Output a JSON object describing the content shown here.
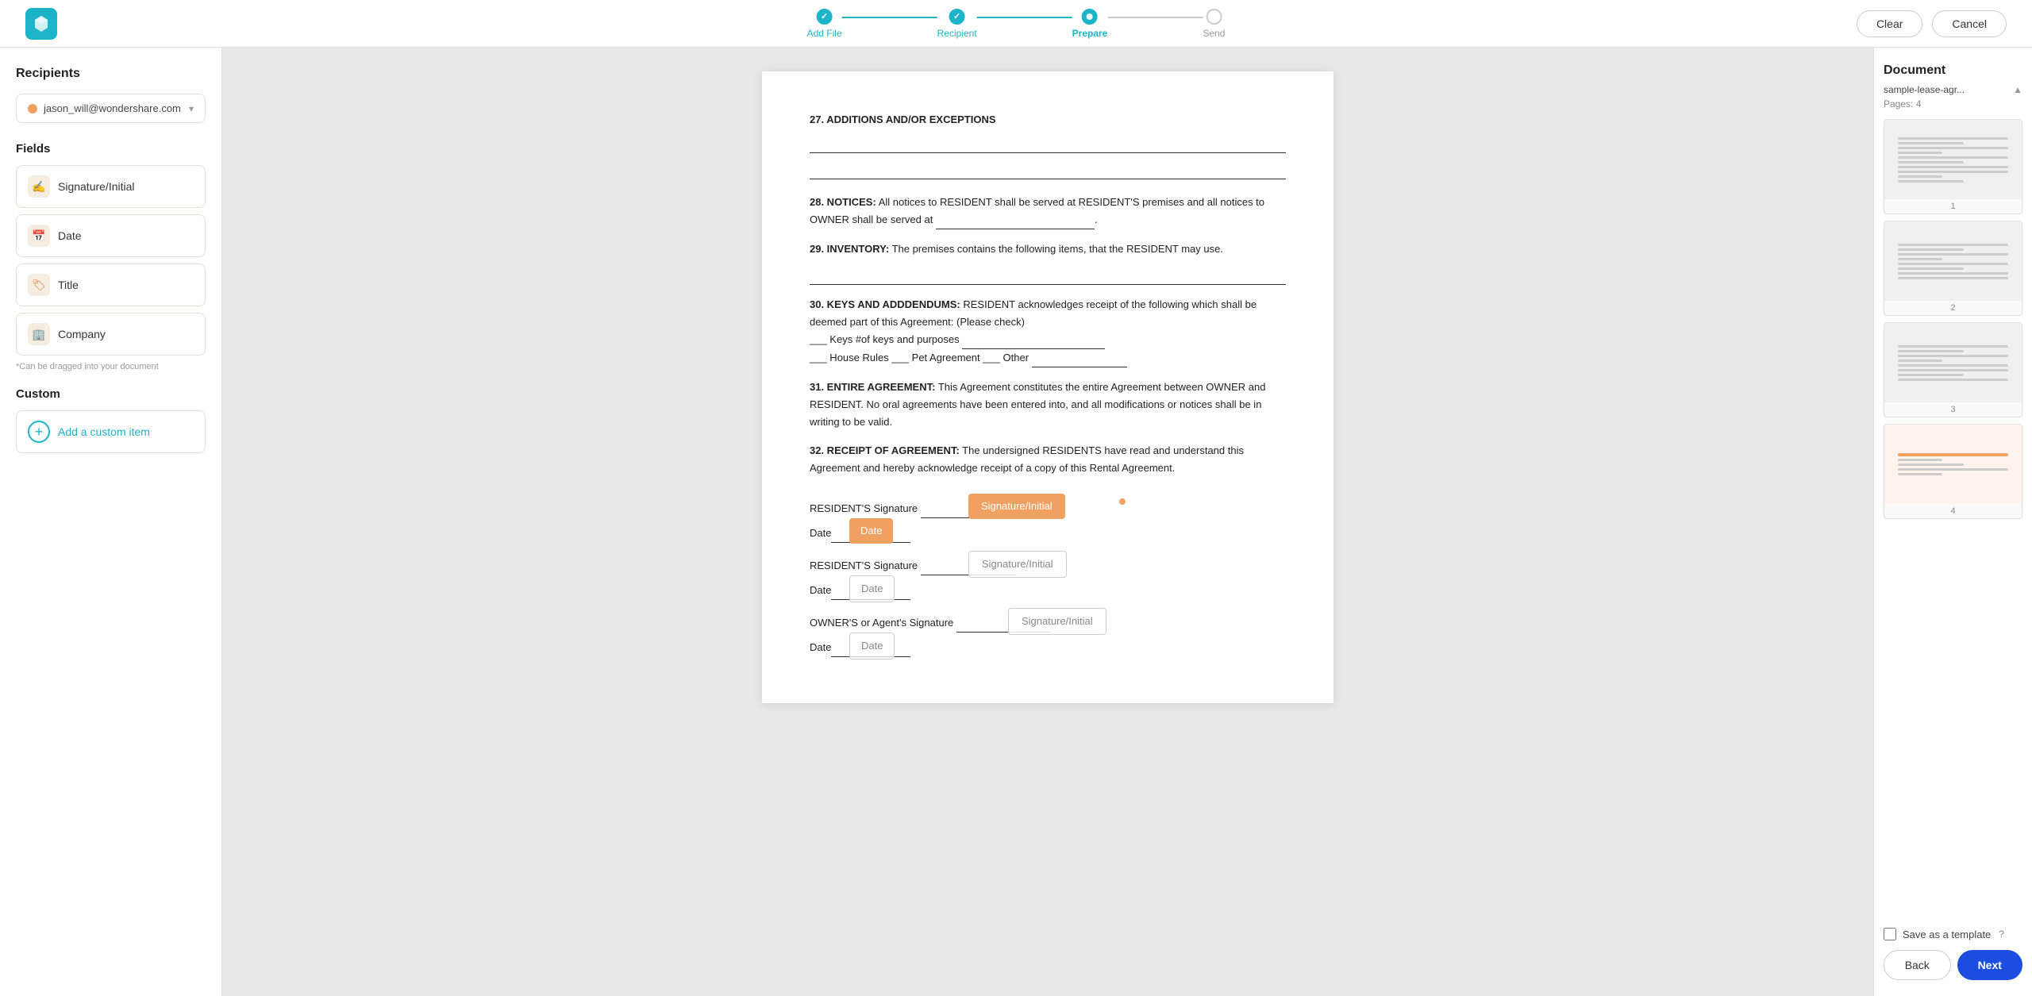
{
  "app": {
    "logo_alt": "Wondershare App"
  },
  "progress": {
    "steps": [
      {
        "id": "add-file",
        "label": "Add File",
        "state": "done"
      },
      {
        "id": "recipient",
        "label": "Recipient",
        "state": "done"
      },
      {
        "id": "prepare",
        "label": "Prepare",
        "state": "active"
      },
      {
        "id": "send",
        "label": "Send",
        "state": "inactive"
      }
    ]
  },
  "topbar": {
    "clear_label": "Clear",
    "cancel_label": "Cancel"
  },
  "sidebar": {
    "recipients_title": "Recipients",
    "recipient_email": "jason_will@wondershare.com",
    "fields_title": "Fields",
    "fields": [
      {
        "id": "signature-initial",
        "icon": "✍",
        "label": "Signature/Initial"
      },
      {
        "id": "date",
        "icon": "📅",
        "label": "Date"
      },
      {
        "id": "title",
        "icon": "🏷",
        "label": "Title"
      },
      {
        "id": "company",
        "icon": "🏢",
        "label": "Company"
      }
    ],
    "hint_text": "*Can be dragged into your document",
    "custom_title": "Custom",
    "add_custom_label": "Add a custom item"
  },
  "document": {
    "sections": [
      {
        "number": "27",
        "heading": "ADDITIONS AND/OR EXCEPTIONS",
        "content": ""
      },
      {
        "number": "28",
        "heading": "NOTICES:",
        "content": "All notices to RESIDENT shall be served at RESIDENT'S premises and all notices to OWNER shall be served at _______________________________________________."
      },
      {
        "number": "29",
        "heading": "INVENTORY:",
        "content": "The premises contains the following items, that the RESIDENT may use."
      },
      {
        "number": "30",
        "heading": "KEYS AND ADDDENDUMS:",
        "content": "RESIDENT acknowledges receipt of the following which shall be deemed part of this Agreement: (Please check)\n___ Keys #of keys and purposes ___________________________________\n___ House Rules ___ Pet Agreement ___ Other ________________________"
      },
      {
        "number": "31",
        "heading": "ENTIRE AGREEMENT:",
        "content": "This Agreement constitutes the entire Agreement between OWNER and RESIDENT. No oral agreements have been entered into, and all modifications or notices shall be in writing to be valid."
      },
      {
        "number": "32",
        "heading": "RECEIPT OF AGREEMENT:",
        "content": "The undersigned RESIDENTS have read and understand this Agreement and hereby acknowledge receipt of a copy of this Rental Agreement."
      }
    ],
    "signature_lines": [
      {
        "label": "RESIDENT'S Signature ____"
      },
      {
        "label": "Date_______________"
      },
      {
        "label": "RESIDENT'S Signature ____"
      },
      {
        "label": "Date_______________"
      },
      {
        "label": "OWNER'S or Agent's Signature _"
      },
      {
        "label": "Date_______________"
      }
    ],
    "overlays": {
      "sig_orange_1": "Signature/Initial",
      "date_orange_1": "Date",
      "sig_outline_1": "Signature/Initial",
      "date_outline_1": "Date",
      "sig_outline_2": "Signature/Initial",
      "date_outline_2": "Date"
    }
  },
  "right_panel": {
    "title": "Document",
    "filename": "sample-lease-agr...",
    "pages_label": "Pages: 4",
    "pages": [
      1,
      2,
      3,
      4
    ],
    "save_template_label": "Save as a template",
    "save_template_help": "?",
    "back_label": "Back",
    "next_label": "Next"
  }
}
